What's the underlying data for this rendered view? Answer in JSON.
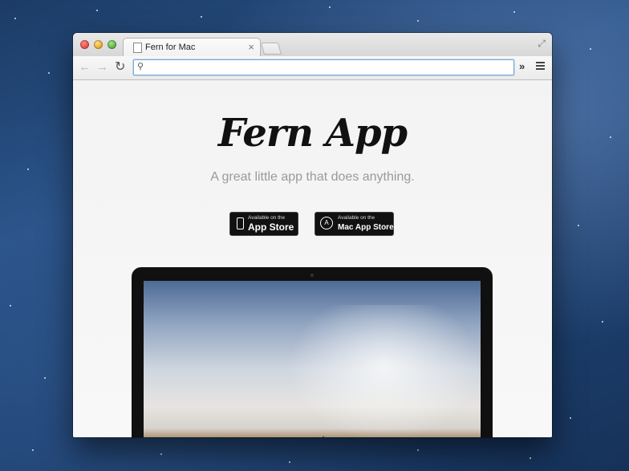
{
  "browser": {
    "tab_title": "Fern for Mac",
    "tab_close": "×",
    "address_value": "",
    "extensions_chevron": "»"
  },
  "hero": {
    "title": "Fern App",
    "tagline": "A great little app that does anything."
  },
  "badges": [
    {
      "small": "Available on the",
      "big": "App Store",
      "icon": "iphone-icon"
    },
    {
      "small": "Available on the",
      "big": "Mac App Store",
      "icon": "mac-app-store-icon"
    }
  ],
  "colors": {
    "omnibox_focus": "#7aa7d8",
    "badge_bg": "#111111"
  }
}
